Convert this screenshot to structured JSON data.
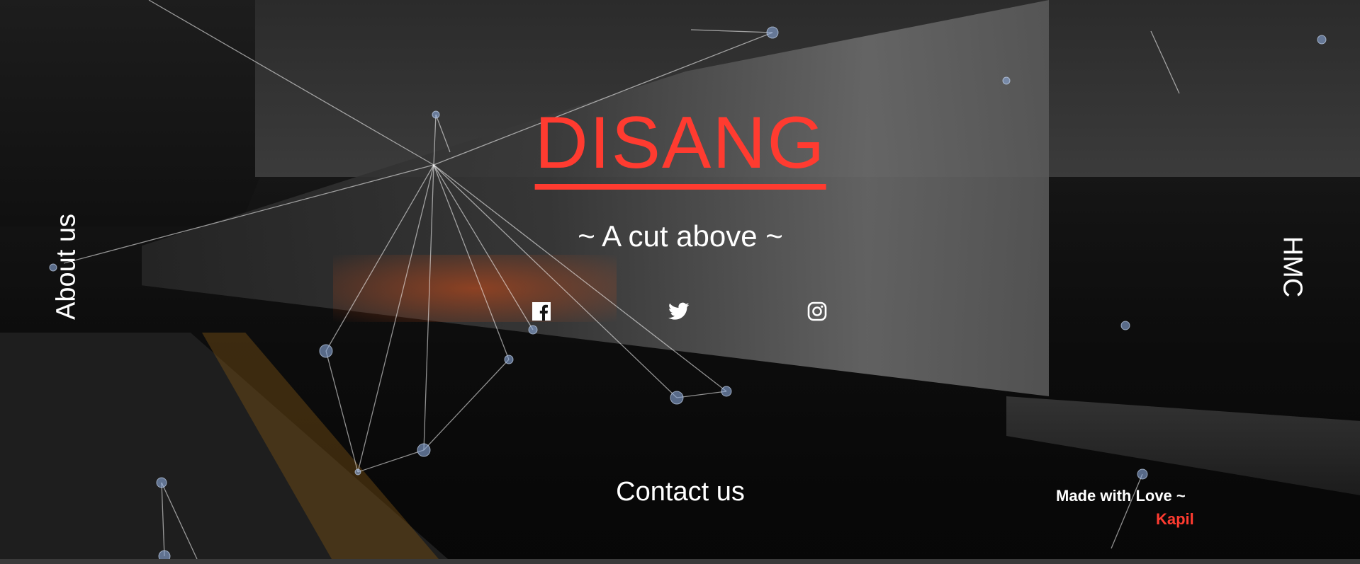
{
  "page": {
    "background": "#151515",
    "accent": "#ff3b30",
    "text_color": "#ffffff"
  },
  "nav": {
    "left_label": "About us",
    "right_label": "HMC"
  },
  "hero": {
    "title": "DISANG",
    "tagline": "~ A cut above ~"
  },
  "social": [
    {
      "name": "facebook-icon"
    },
    {
      "name": "twitter-icon"
    },
    {
      "name": "instagram-icon"
    }
  ],
  "footer": {
    "contact_label": "Contact us",
    "credit_text": "Made with Love ~",
    "credit_name": "Kapil"
  }
}
